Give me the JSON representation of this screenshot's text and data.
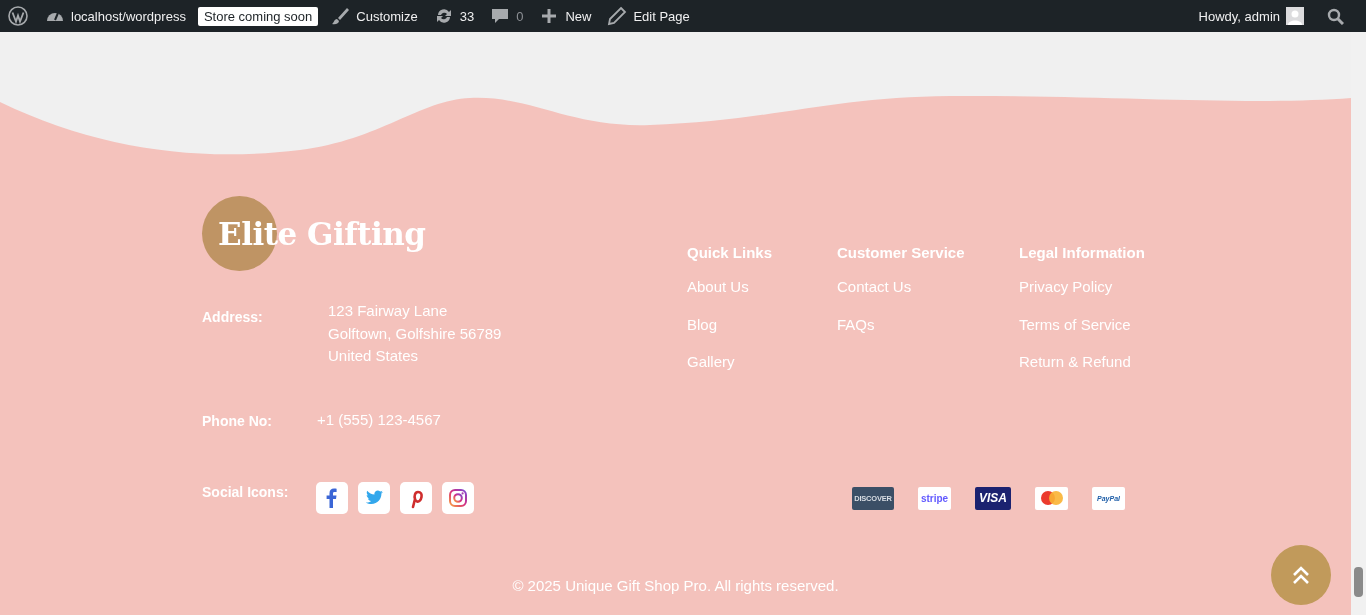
{
  "admin_bar": {
    "site": "localhost/wordpress",
    "store_badge": "Store coming soon",
    "customize": "Customize",
    "updates": "33",
    "comments": "0",
    "new": "New",
    "edit": "Edit Page",
    "greeting": "Howdy, admin"
  },
  "footer": {
    "logo": "Elite Gifting",
    "contact": [
      {
        "label": "Address:",
        "lines": [
          "123 Fairway Lane",
          "Golftown, Golfshire 56789",
          "United States"
        ]
      },
      {
        "label": "Phone No:",
        "lines": [
          "+1 (555) 123-4567"
        ]
      }
    ],
    "social_label": "Social Icons:",
    "social": [
      {
        "kind": "facebook"
      },
      {
        "kind": "twitter"
      },
      {
        "kind": "pinterest"
      },
      {
        "kind": "instagram"
      }
    ],
    "columns": [
      {
        "heading": "Quick Links",
        "links": [
          "About Us",
          "Blog",
          "Gallery"
        ]
      },
      {
        "heading": "Customer Service",
        "links": [
          "Contact Us",
          "FAQs"
        ]
      },
      {
        "heading": "Legal Information",
        "links": [
          "Privacy Policy",
          "Terms of Service",
          "Return & Refund"
        ]
      }
    ],
    "payments": [
      {
        "kind": "discover",
        "label": "DISCOVER"
      },
      {
        "kind": "stripe",
        "label": "stripe"
      },
      {
        "kind": "visa",
        "label": "VISA"
      },
      {
        "kind": "mastercard"
      },
      {
        "kind": "paypal",
        "label": "PayPal"
      }
    ],
    "copyright": "© 2025 Unique Gift Shop Pro. All rights reserved."
  }
}
